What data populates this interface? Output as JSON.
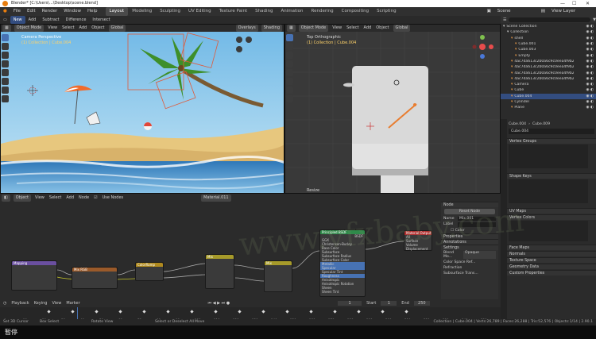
{
  "app": {
    "title": "Blender* [C:\\Users\\...\\Desktop\\scene.blend]",
    "window_controls": [
      "—",
      "☐",
      "✕"
    ]
  },
  "menu": {
    "items": [
      "File",
      "Edit",
      "Render",
      "Window",
      "Help"
    ],
    "tabs": [
      "Layout",
      "Modeling",
      "Sculpting",
      "UV Editing",
      "Texture Paint",
      "Shading",
      "Animation",
      "Rendering",
      "Compositing",
      "Scripting"
    ],
    "active_tab": "Layout",
    "scene_label": "Scene",
    "view_layer_label": "View Layer"
  },
  "toolbar": {
    "items": [
      "New",
      "Add",
      "Subtract",
      "Difference",
      "Intersect"
    ],
    "active": "New"
  },
  "viewport_left": {
    "mode": "Object Mode",
    "menus": [
      "View",
      "Select",
      "Add",
      "Object"
    ],
    "transform": "Global",
    "overlays": "Overlays",
    "shading": "Shading",
    "info_line1": "Camera Perspective",
    "info_line2": "(1) Collection | Cube.004"
  },
  "viewport_right": {
    "mode": "Object Mode",
    "menus": [
      "View",
      "Select",
      "Add",
      "Object"
    ],
    "transform": "Global",
    "info_line1": "Top Orthographic",
    "info_line2": "(1) Collection | Cube.004",
    "operator_panel": "Resize"
  },
  "node_editor": {
    "header": [
      "Object",
      "View",
      "Select",
      "Add",
      "Node",
      "Use Nodes"
    ],
    "material": "Material.011",
    "nodes": [
      {
        "title": "Mapping",
        "color": "#6a4fa0"
      },
      {
        "title": "Mix RGB",
        "color": "#9a5a2a"
      },
      {
        "title": "ColorRamp",
        "color": "#b08a1e"
      },
      {
        "title": "Mix",
        "color": "#a69a2a"
      },
      {
        "title": "Mix",
        "color": "#a69a2a"
      },
      {
        "title": "Principled BSDF",
        "color": "#2f8a4a"
      },
      {
        "title": "Material Output",
        "color": "#b03030"
      }
    ],
    "bsdf_label": "BSDF",
    "bsdf_rows": [
      "GGX",
      "Christensen-Burley",
      "Base Color",
      "Subsurface",
      "Subsurface Radius",
      "Subsurface Color",
      "Metallic",
      "Specular",
      "Specular Tint",
      "Roughness",
      "Anisotropic",
      "Anisotropic Rotation",
      "Sheen",
      "Sheen Tint"
    ],
    "output_rows": [
      "All",
      "Surface",
      "Volume",
      "Displacement"
    ]
  },
  "node_sidebar": {
    "title": "Node",
    "reset": "Reset Node",
    "name_label": "Name",
    "name_value": "Mix.001",
    "label_label": "Label",
    "color_label": "Color",
    "properties_label": "Properties",
    "annotations_label": "Annotations",
    "settings_label": "Settings",
    "blend_mode_label": "Blend Mo...",
    "blend_mode_value": "Opaque",
    "color_space_label": "Color Space Ref...",
    "refraction_label": "Refraction",
    "subsurface_label": "Subsurface Trans..."
  },
  "outliner": {
    "header": "Scene Collection",
    "rows": [
      {
        "name": "Scene Collection",
        "indent": 0,
        "icon": "#cfcfcf"
      },
      {
        "name": "Collection",
        "indent": 1,
        "icon": "#cfcfcf"
      },
      {
        "name": "shell",
        "indent": 2,
        "icon": "#e89a4a"
      },
      {
        "name": "Cube.001",
        "indent": 3,
        "icon": "#e89a4a"
      },
      {
        "name": "Cube.003",
        "indent": 3,
        "icon": "#e89a4a"
      },
      {
        "name": "Empty",
        "indent": 3,
        "icon": "#e89a4a"
      },
      {
        "name": "4ac7da613c2b0a6c9c0eea4f9b2e4e",
        "indent": 2,
        "icon": "#e89a4a"
      },
      {
        "name": "4ac7da613c2b0a6c9c0eea4f9b2e4e",
        "indent": 2,
        "icon": "#e89a4a"
      },
      {
        "name": "4ac7da613c2b0a6c9c0eea4f9b2e4e",
        "indent": 2,
        "icon": "#e89a4a"
      },
      {
        "name": "4ac7da613c2b0a6c9c0eea4f9b2e4e",
        "indent": 2,
        "icon": "#e89a4a"
      },
      {
        "name": "Camera",
        "indent": 2,
        "icon": "#e89a4a"
      },
      {
        "name": "Cube",
        "indent": 2,
        "icon": "#e89a4a"
      },
      {
        "name": "Cube.004",
        "indent": 2,
        "icon": "#e89a4a"
      },
      {
        "name": "Cylinder",
        "indent": 2,
        "icon": "#e89a4a"
      },
      {
        "name": "Plane",
        "indent": 2,
        "icon": "#e89a4a"
      }
    ]
  },
  "properties": {
    "object_tab": "Cube.004",
    "data_tab": "Cube.009",
    "mesh_name": "Cube.004",
    "sections": [
      "Vertex Groups",
      "Shape Keys",
      "UV Maps",
      "Vertex Colors",
      "Face Maps",
      "Normals",
      "Texture Space",
      "Geometry Data",
      "Custom Properties"
    ]
  },
  "timeline": {
    "menus": [
      "Playback",
      "Keying",
      "View",
      "Marker"
    ],
    "current_frame": "1",
    "start_label": "Start",
    "start": "1",
    "end_label": "End",
    "end": "250",
    "ticks": [
      "0",
      "10",
      "20",
      "30",
      "40",
      "50",
      "60",
      "70",
      "80",
      "90",
      "100",
      "110",
      "120",
      "130",
      "140",
      "150",
      "160",
      "170",
      "180",
      "190",
      "200",
      "210",
      "220",
      "230",
      "240",
      "250"
    ]
  },
  "statusbar": {
    "left": "Set 3D Cursor",
    "l2": "Box Select",
    "l3": "Rotate View",
    "l4": "Select or Deselect All",
    "l5": "Move",
    "right": "Collection | Cube.004 | Verts:26,789 | Faces:26,288 | Tris:52,576 | Objects:1/14 | 2.90.1"
  },
  "subtitle": {
    "text": "暂停"
  },
  "watermark": "www.vfxbaby.com"
}
